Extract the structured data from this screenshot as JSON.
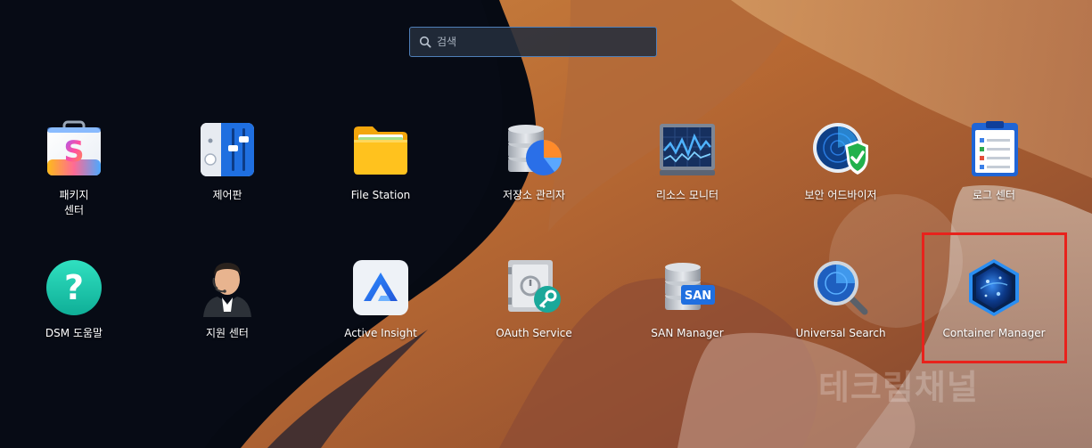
{
  "search": {
    "placeholder": "검색",
    "value": ""
  },
  "apps": [
    {
      "id": "package-center",
      "label": "패키지\n센터",
      "icon": "package-center-icon"
    },
    {
      "id": "control-panel",
      "label": "제어판",
      "icon": "control-panel-icon"
    },
    {
      "id": "file-station",
      "label": "File Station",
      "icon": "folder-icon"
    },
    {
      "id": "storage-manager",
      "label": "저장소 관리자",
      "icon": "storage-manager-icon"
    },
    {
      "id": "resource-monitor",
      "label": "리소스 모니터",
      "icon": "resource-monitor-icon"
    },
    {
      "id": "security-advisor",
      "label": "보안 어드바이저",
      "icon": "security-advisor-icon"
    },
    {
      "id": "log-center",
      "label": "로그 센터",
      "icon": "log-center-icon"
    },
    {
      "id": "dsm-help",
      "label": "DSM 도움말",
      "icon": "help-icon"
    },
    {
      "id": "support-center",
      "label": "지원 센터",
      "icon": "support-center-icon"
    },
    {
      "id": "active-insight",
      "label": "Active Insight",
      "icon": "active-insight-icon"
    },
    {
      "id": "oauth-service",
      "label": "OAuth Service",
      "icon": "oauth-service-icon"
    },
    {
      "id": "san-manager",
      "label": "SAN Manager",
      "icon": "san-manager-icon"
    },
    {
      "id": "universal-search",
      "label": "Universal Search",
      "icon": "universal-search-icon"
    },
    {
      "id": "container-manager",
      "label": "Container Manager",
      "icon": "container-manager-icon"
    }
  ],
  "icon_badges": {
    "package_center_letter": "S",
    "san_badge": "SAN"
  },
  "watermark": {
    "text": "테크림채널"
  },
  "colors": {
    "search_border": "#4f7fb8",
    "highlight": "#e8221c",
    "label_text": "#ffffff"
  }
}
